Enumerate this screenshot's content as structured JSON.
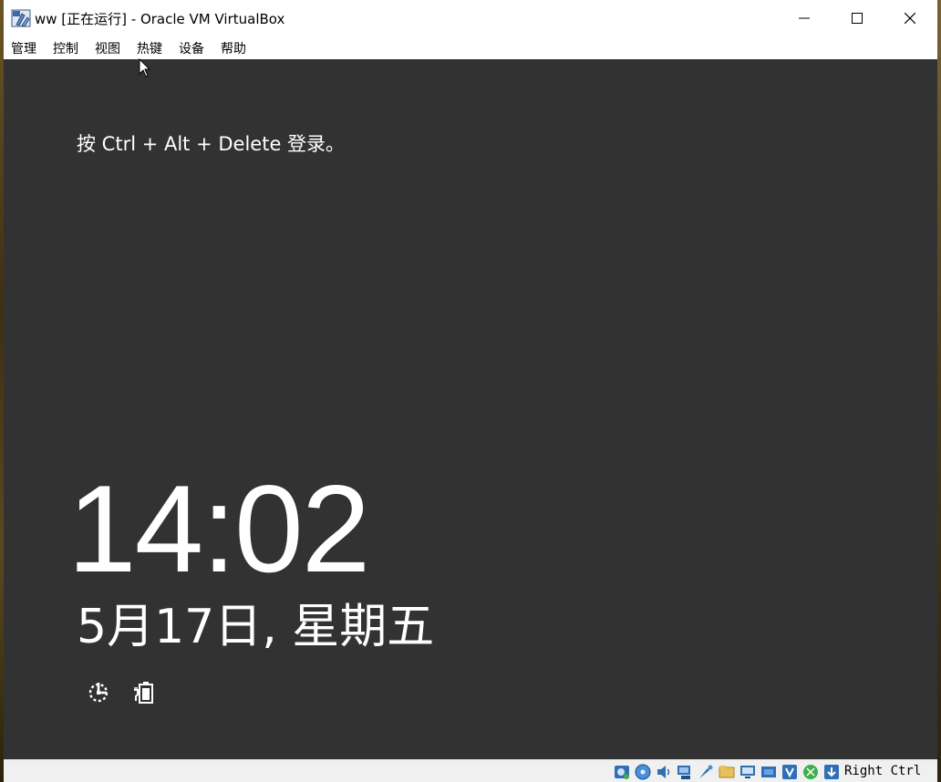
{
  "window": {
    "title": "ww [正在运行] - Oracle VM VirtualBox",
    "icon": "virtualbox-icon",
    "controls": {
      "minimize": "minimize-icon",
      "maximize": "maximize-icon",
      "close": "close-icon"
    }
  },
  "menubar": {
    "items": [
      {
        "label": "管理"
      },
      {
        "label": "控制"
      },
      {
        "label": "视图"
      },
      {
        "label": "热键"
      },
      {
        "label": "设备"
      },
      {
        "label": "帮助"
      }
    ]
  },
  "vm_screen": {
    "background": "#323232",
    "login_hint": "按 Ctrl + Alt + Delete 登录。",
    "time": "14:02",
    "date": "5月17日, 星期五",
    "status_icons": [
      "network-icon",
      "battery-icon"
    ]
  },
  "statusbar": {
    "icons": [
      "hard-disk-icon",
      "optical-drive-icon",
      "audio-icon",
      "network-adapter-icon",
      "usb-icon",
      "shared-folders-icon",
      "display-icon",
      "video-capture-icon",
      "virtualization-icon",
      "mouse-integration-icon",
      "keyboard-capture-icon"
    ],
    "host_key": "Right Ctrl"
  }
}
